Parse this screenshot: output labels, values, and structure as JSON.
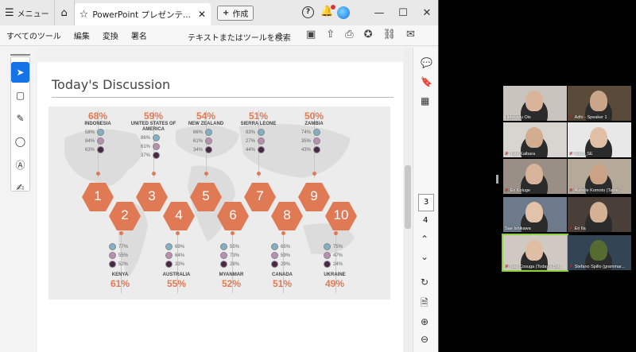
{
  "window": {
    "menu_label": "メニュー",
    "tab_title": "PowerPoint プレゼンテ...",
    "new_tab_label": "作成"
  },
  "toolbar": {
    "items": [
      "すべてのツール",
      "編集",
      "変換",
      "署名"
    ],
    "search_label": "テキストまたはツールを検索"
  },
  "page": {
    "title": "Today's Discussion",
    "current_page": "3",
    "next_page": "4"
  },
  "infographic": {
    "hexagons": [
      "1",
      "2",
      "3",
      "4",
      "5",
      "6",
      "7",
      "8",
      "9",
      "10"
    ],
    "top": [
      {
        "pct": "68%",
        "name": "INDONESIA",
        "v": [
          "58%",
          "84%",
          "63%"
        ]
      },
      {
        "pct": "59%",
        "name": "UNITED STATES OF AMERICA",
        "v": [
          "86%",
          "61%",
          "37%"
        ]
      },
      {
        "pct": "54%",
        "name": "NEW ZEALAND",
        "v": [
          "66%",
          "61%",
          "34%"
        ]
      },
      {
        "pct": "51%",
        "name": "SIERRA LEONE",
        "v": [
          "83%",
          "27%",
          "44%"
        ]
      },
      {
        "pct": "50%",
        "name": "ZAMBIA",
        "v": [
          "74%",
          "35%",
          "43%"
        ]
      }
    ],
    "bottom": [
      {
        "pct": "61%",
        "name": "KENYA",
        "v": [
          "77%",
          "55%",
          "52%"
        ]
      },
      {
        "pct": "55%",
        "name": "AUSTRALIA",
        "v": [
          "69%",
          "64%",
          "33%"
        ]
      },
      {
        "pct": "52%",
        "name": "MYANMAR",
        "v": [
          "55%",
          "73%",
          "28%"
        ]
      },
      {
        "pct": "51%",
        "name": "CANADA",
        "v": [
          "65%",
          "59%",
          "29%"
        ]
      },
      {
        "pct": "49%",
        "name": "UKRAINE",
        "v": [
          "75%",
          "47%",
          "24%"
        ]
      }
    ],
    "accent_color": "#e07a55"
  },
  "participants": [
    {
      "name": "Hidekazu Ois",
      "muted": false
    },
    {
      "name": "Adhi - Speaker 1",
      "muted": true
    },
    {
      "name": "Yuto Kaibara",
      "muted": true
    },
    {
      "name": "Maru_SE",
      "muted": true
    },
    {
      "name": "Eri Koluge",
      "muted": true
    },
    {
      "name": "Aishide Komoto (Table ...",
      "muted": true
    },
    {
      "name": "Sae Ishikawa",
      "muted": false
    },
    {
      "name": "Eri Ila",
      "muted": true
    },
    {
      "name": "Nao Cosuga (Today's Dis...",
      "muted": true
    },
    {
      "name": "Stefano Spillo (grammar...",
      "muted": true
    }
  ]
}
